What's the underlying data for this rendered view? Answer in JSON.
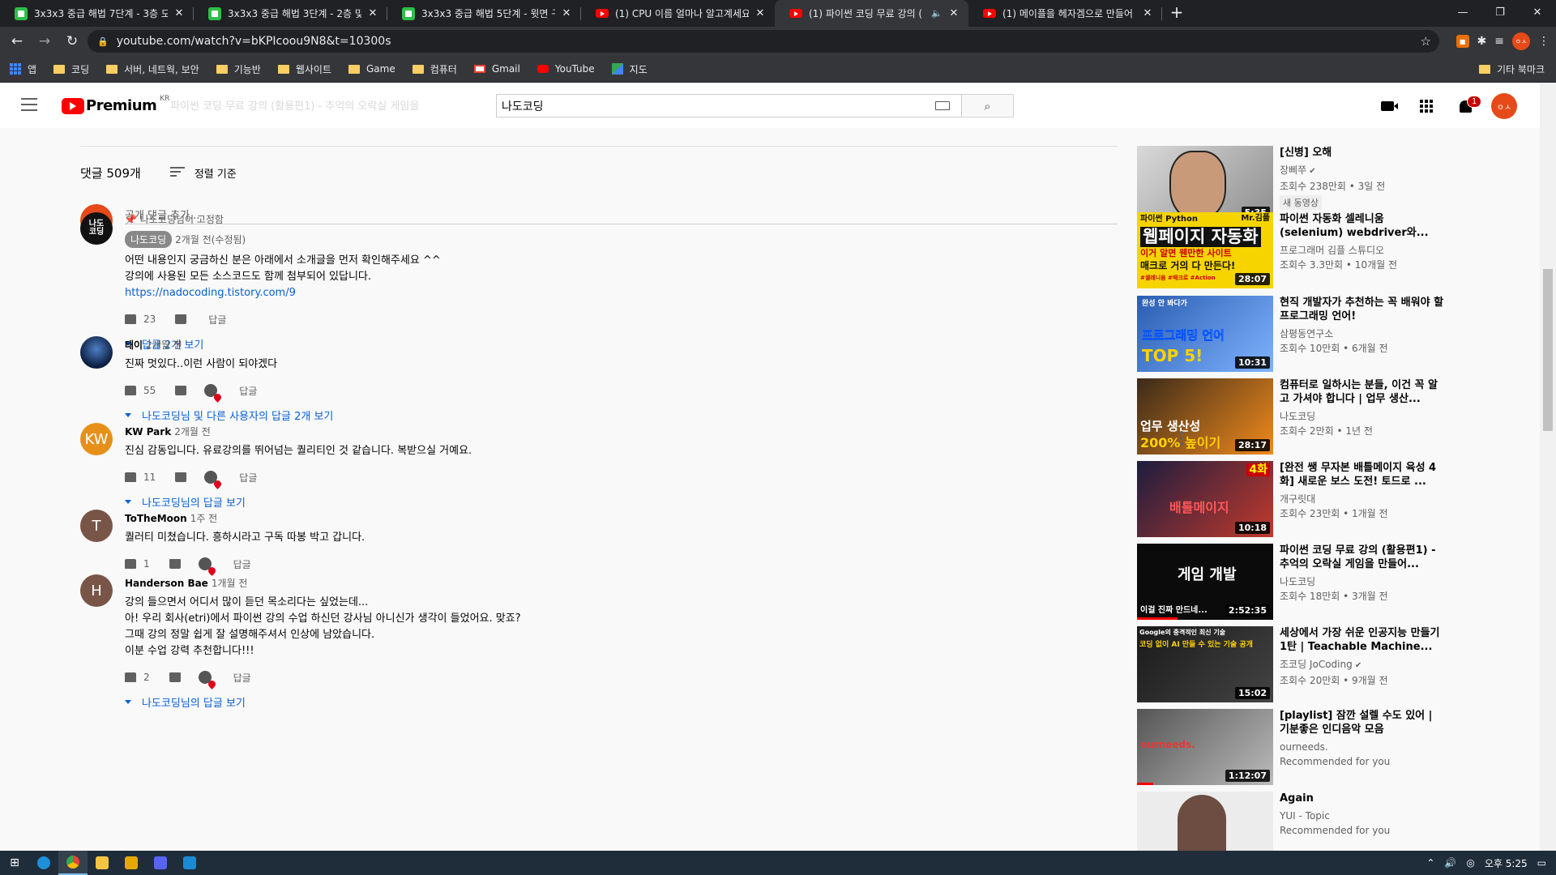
{
  "browser": {
    "tabs": [
      {
        "title": "3x3x3 중급 해법 7단계 - 3층 모",
        "icon": "green"
      },
      {
        "title": "3x3x3 중급 해법 3단계 - 2층 맞",
        "icon": "green"
      },
      {
        "title": "3x3x3 중급 해법 5단계 - 윗면 구",
        "icon": "green"
      },
      {
        "title": "(1) CPU 이름 얼마나 알고계세요",
        "icon": "red"
      },
      {
        "title": "(1) 파이썬 코딩 무료 강의 (",
        "icon": "red",
        "active": true
      },
      {
        "title": "(1) 메이플을 헤자겜으로 만들어",
        "icon": "red"
      }
    ],
    "url": "youtube.com/watch?v=bKPIcoou9N8&t=10300s",
    "bookmarks": [
      "앱",
      "코딩",
      "서버, 네트웍, 보안",
      "기능반",
      "웹사이트",
      "Game",
      "컴퓨터",
      "Gmail",
      "YouTube",
      "지도"
    ],
    "other_bookmarks": "기타 북마크",
    "ext_avatar": "ㅇㅅ"
  },
  "yt": {
    "logo": "Premium",
    "region": "KR",
    "search_value": "나도코딩",
    "ghost_title": "파이썬 코딩 무료 강의 (활용편1) - 추억의 오락실 게임을",
    "notif_count": "1",
    "avatar": "ㅇㅅ"
  },
  "comments_header": {
    "count": "댓글 509개",
    "sort": "정렬 기준",
    "add_placeholder": "공개 댓글 추가...",
    "my_avatar": "ㅇㅅ"
  },
  "comments": [
    {
      "pinned": "나도코딩님이 고정함",
      "author": "나도코딩",
      "time": "2개월 전(수정됨)",
      "lines": [
        "어떤 내용인지 궁금하신 분은 아래에서 소개글을 먼저 확인해주세요 ^^",
        "강의에 사용된 모든 소스코드도 함께 첨부되어 있답니다."
      ],
      "link": "https://nadocoding.tistory.com/9",
      "likes": "23",
      "reply": "답글",
      "more": "답글 2개 보기",
      "avatar": "나도\n코딩"
    },
    {
      "author": "태이",
      "time": "2개월 전",
      "lines": [
        "진짜 멋있다..이런 사람이 되야겠다"
      ],
      "likes": "55",
      "reply": "답글",
      "more": "나도코딩님 및 다른 사용자의 답글 2개 보기"
    },
    {
      "author": "KW Park",
      "time": "2개월 전",
      "lines": [
        "진심 감동입니다. 유료강의를 뛰어넘는 퀄리티인 것 같습니다. 복받으실 거예요."
      ],
      "likes": "11",
      "reply": "답글",
      "more": "나도코딩님의 답글 보기",
      "avatar": "KW"
    },
    {
      "author": "ToTheMoon",
      "time": "1주 전",
      "lines": [
        "퀄러티 미쳤습니다. 흥하시라고 구독 따봉 박고 갑니다."
      ],
      "likes": "1",
      "reply": "답글",
      "avatar": "T"
    },
    {
      "author": "Handerson Bae",
      "time": "1개월 전",
      "lines": [
        "강의 들으면서 어디서 많이 듣던 목소리다는 싶었는데...",
        "아! 우리 회사(etri)에서 파이썬 강의 수업 하신던 강사님 아니신가 생각이 들었어요. 맞죠?",
        "그때 강의 정말 쉽게 잘 설명해주셔서 인상에 남았습니다.",
        "이분 수업 강력 추천합니다!!!"
      ],
      "likes": "2",
      "reply": "답글",
      "more": "나도코딩님의 답글 보기",
      "avatar": "H"
    }
  ],
  "sidebar": [
    {
      "title": "[신병] 오해",
      "channel": "장삐쭈",
      "meta": "조회수 238만회 • 3일 전",
      "badge": "새 동영상",
      "duration": "5:35"
    },
    {
      "title": "파이썬 자동화 셀레니움 (selenium) webdriver와...",
      "channel": "프로그래머 김플 스튜디오",
      "meta": "조회수 3.3만회 • 10개월 전",
      "duration": "28:07",
      "thumb_text": {
        "top": "파이썬 Python",
        "brand": "Mr.김플",
        "big": "웹페이지 자동화",
        "mid": "이거 알면 웬만한 사이트",
        "low": "매크로 거의 다 만든다!",
        "tags": "#셀레니움 #매크로 #Action"
      }
    },
    {
      "title": "현직 개발자가 추천하는 꼭 배워야 할 프로그래밍 언어!",
      "channel": "삼평동연구소",
      "meta": "조회수 10만회 • 6개월 전",
      "duration": "10:31",
      "thumb_text": {
        "top": "완성 안 봐다가",
        "big": "프로그래밍 언어",
        "rank": "TOP 5!"
      }
    },
    {
      "title": "컴퓨터로 일하시는 분들, 이건 꼭 알고 가셔야 합니다 | 업무 생산...",
      "channel": "나도코딩",
      "meta": "조회수 2만회 • 1년 전",
      "duration": "28:17",
      "thumb_text": {
        "big": "업무 생산성",
        "low": "200% 높이기"
      }
    },
    {
      "title": "[완전 쌩 무자본 배틀메이지 육성 4화] 새로운 보스 도전! 토드로 ...",
      "channel": "개구릿대",
      "meta": "조회수 23만회 • 1개월 전",
      "duration": "10:18",
      "thumb_text": {
        "ep": "4화",
        "big": "배틀메이지"
      }
    },
    {
      "title": "파이썬 코딩 무료 강의 (활용편1) - 추억의 오락실 게임을 만들어...",
      "channel": "나도코딩",
      "meta": "조회수 18만회 • 3개월 전",
      "duration": "2:52:35",
      "thumb_text": {
        "big": "게임 개발",
        "low": "이걸 진짜 만드네..."
      }
    },
    {
      "title": "세상에서 가장 쉬운 인공지능 만들기 1탄 | Teachable Machine...",
      "channel": "조코딩 JoCoding",
      "meta": "조회수 20만회 • 9개월 전",
      "duration": "15:02",
      "thumb_text": {
        "top": "Google의 충격적인 최신 기술",
        "big": "코딩 없이 AI 만들 수 있는 기술 공개"
      }
    },
    {
      "title": "[playlist] 잠깐 설렐 수도 있어 | 기분좋은 인디음악 모음",
      "channel": "ourneeds.",
      "meta": "Recommended for you",
      "duration": "1:12:07",
      "thumb_text": {
        "brand": "ourneeds."
      }
    },
    {
      "title": "Again",
      "channel": "YUI - Topic",
      "meta": "Recommended for you",
      "duration": ""
    }
  ],
  "taskbar": {
    "time": "오후 5:25"
  }
}
